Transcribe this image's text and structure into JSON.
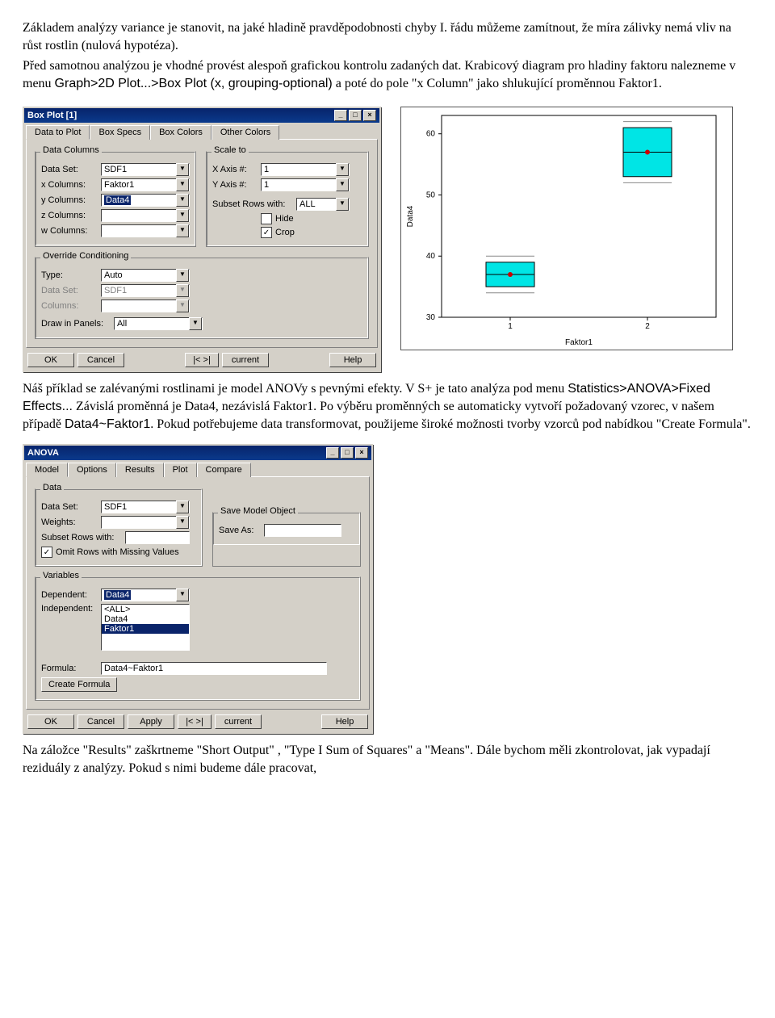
{
  "para1": "Základem analýzy variance je stanovit, na jaké hladině pravděpodobnosti chyby I. řádu můžeme zamítnout, že míra zálivky nemá vliv na růst rostlin (nulová hypotéza).",
  "para2a": "Před samotnou analýzou je vhodné provést alespoň grafickou kontrolu zadaných dat. Krabicový diagram pro hladiny faktoru nalezneme v menu ",
  "para2b": "Graph>2D Plot...>Box Plot (x, grouping-optional)",
  "para2c": " a poté do pole \"x Column\" jako shlukující proměnnou Faktor1.",
  "para3a": "Náš příklad se zalévanými rostlinami je model ANOVy s pevnými efekty. V S+ je tato analýza pod menu ",
  "para3b": "Statistics>ANOVA>Fixed Effects...",
  "para3c": " Závislá proměnná je Data4, nezávislá Faktor1. Po výběru proměnných se automaticky vytvoří požadovaný vzorec, v našem případě ",
  "para3d": "Data4~Faktor1",
  "para3e": ". Pokud potřebujeme data transformovat, použijeme široké možnosti tvorby vzorců pod nabídkou \"Create Formula\".",
  "para4": "Na záložce \"Results\" zaškrtneme \"Short Output\" , \"Type I Sum of Squares\" a \"Means\". Dále bychom měli zkontrolovat, jak vypadají reziduály z analýzy. Pokud s nimi budeme dále pracovat,",
  "boxplot_dialog": {
    "title": "Box Plot [1]",
    "tabs": [
      "Data to Plot",
      "Box Specs",
      "Box Colors",
      "Other Colors"
    ],
    "groups": {
      "data_columns": "Data Columns",
      "scale_to": "Scale to",
      "override": "Override Conditioning"
    },
    "labels": {
      "dataset": "Data Set:",
      "xcol": "x Columns:",
      "ycol": "y Columns:",
      "zcol": "z Columns:",
      "wcol": "w Columns:",
      "xaxis": "X Axis #:",
      "yaxis": "Y Axis #:",
      "subset": "Subset Rows with:",
      "hide": "Hide",
      "crop": "Crop",
      "type": "Type:",
      "dataset2": "Data Set:",
      "columns2": "Columns:",
      "draw": "Draw in Panels:"
    },
    "values": {
      "dataset": "SDF1",
      "xcol": "Faktor1",
      "ycol": "Data4",
      "zcol": "",
      "wcol": "",
      "xaxis": "1",
      "yaxis": "1",
      "subset": "ALL",
      "hide": false,
      "crop": true,
      "type": "Auto",
      "dataset2": "SDF1",
      "columns2": "",
      "draw": "All"
    },
    "buttons": {
      "ok": "OK",
      "cancel": "Cancel",
      "nav": "|< >|",
      "current": "current",
      "help": "Help"
    }
  },
  "chart_data": {
    "type": "boxplot",
    "title": "",
    "xlabel": "Faktor1",
    "ylabel": "Data4",
    "xticks": [
      "1",
      "2"
    ],
    "yticks": [
      30,
      40,
      50,
      60
    ],
    "ylim": [
      30,
      63
    ],
    "series": [
      {
        "category": "1",
        "min": 34,
        "q1": 35,
        "median": 37,
        "q3": 39,
        "max": 40
      },
      {
        "category": "2",
        "min": 52,
        "q1": 53,
        "median": 57,
        "q3": 61,
        "max": 62
      }
    ]
  },
  "anova_dialog": {
    "title": "ANOVA",
    "tabs": [
      "Model",
      "Options",
      "Results",
      "Plot",
      "Compare"
    ],
    "groups": {
      "data": "Data",
      "save": "Save Model Object",
      "vars": "Variables"
    },
    "labels": {
      "dataset": "Data Set:",
      "weights": "Weights:",
      "subset": "Subset Rows with:",
      "omit": "Omit Rows with Missing Values",
      "saveas": "Save As:",
      "dep": "Dependent:",
      "indep": "Independent:",
      "formula": "Formula:",
      "create": "Create Formula"
    },
    "values": {
      "dataset": "SDF1",
      "weights": "",
      "subset": "",
      "omit": true,
      "saveas": "",
      "dep": "Data4",
      "indep_options": [
        "<ALL>",
        "Data4",
        "Faktor1"
      ],
      "indep_selected": "Faktor1",
      "formula": "Data4~Faktor1"
    },
    "buttons": {
      "ok": "OK",
      "cancel": "Cancel",
      "apply": "Apply",
      "nav": "|< >|",
      "current": "current",
      "help": "Help"
    }
  }
}
